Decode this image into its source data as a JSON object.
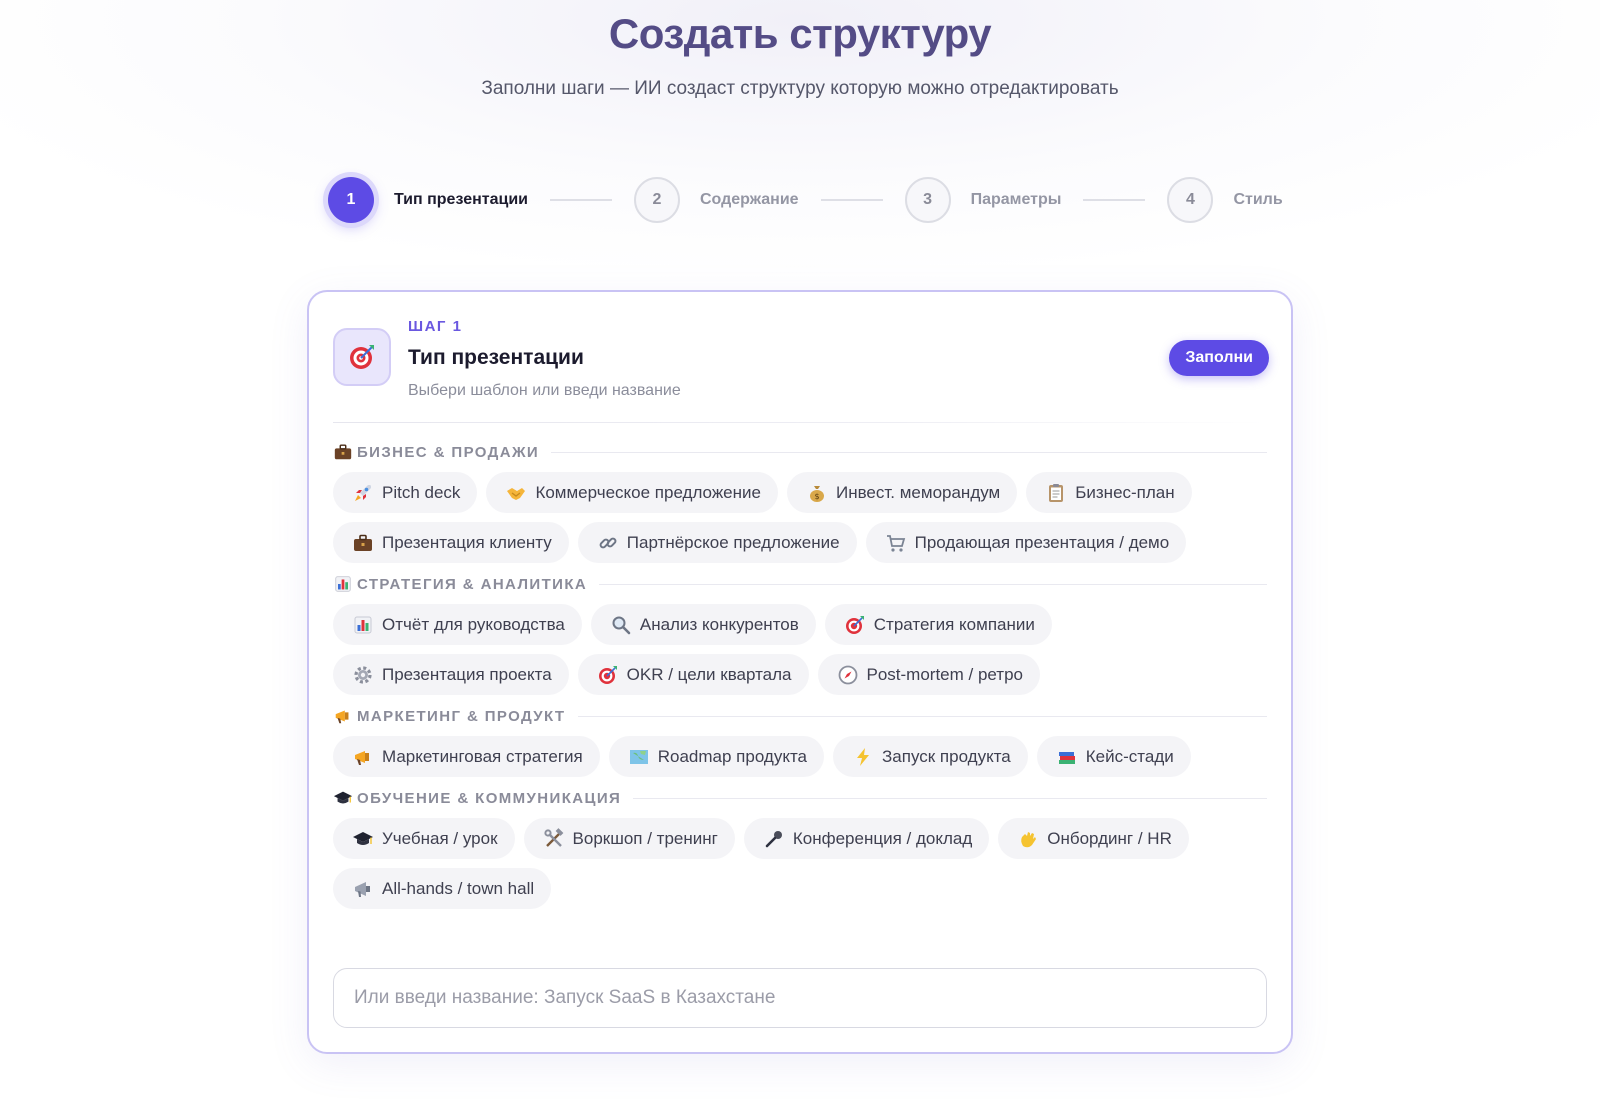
{
  "header": {
    "title": "Создать структуру",
    "subtitle": "Заполни шаги — ИИ создаст структуру которую можно отредактировать"
  },
  "stepper": [
    {
      "number": "1",
      "label": "Тип презентации",
      "active": true
    },
    {
      "number": "2",
      "label": "Содержание",
      "active": false
    },
    {
      "number": "3",
      "label": "Параметры",
      "active": false
    },
    {
      "number": "4",
      "label": "Стиль",
      "active": false
    }
  ],
  "card": {
    "step_tag": "ШАГ 1",
    "title": "Тип презентации",
    "description": "Выбери шаблон или введи название",
    "icon": "target-icon",
    "fill_button": "Заполни"
  },
  "sections": [
    {
      "title": "БИЗНЕС & ПРОДАЖИ",
      "icon": "briefcase-icon",
      "rows": [
        [
          {
            "label": "Pitch deck",
            "icon": "rocket-icon"
          },
          {
            "label": "Коммерческое предложение",
            "icon": "handshake-icon"
          },
          {
            "label": "Инвест. меморандум",
            "icon": "money-bag-icon"
          },
          {
            "label": "Бизнес-план",
            "icon": "clipboard-icon"
          }
        ],
        [
          {
            "label": "Презентация клиенту",
            "icon": "briefcase-icon"
          },
          {
            "label": "Партнёрское предложение",
            "icon": "link-icon"
          },
          {
            "label": "Продающая презентация / демо",
            "icon": "cart-icon"
          }
        ]
      ]
    },
    {
      "title": "СТРАТЕГИЯ & АНАЛИТИКА",
      "icon": "bar-chart-icon",
      "rows": [
        [
          {
            "label": "Отчёт для руководства",
            "icon": "bar-chart-icon"
          },
          {
            "label": "Анализ конкурентов",
            "icon": "magnifier-icon"
          },
          {
            "label": "Стратегия компании",
            "icon": "target-icon"
          }
        ],
        [
          {
            "label": "Презентация проекта",
            "icon": "gear-icon"
          },
          {
            "label": "OKR / цели квартала",
            "icon": "target-icon"
          },
          {
            "label": "Post-mortem / ретро",
            "icon": "compass-icon"
          }
        ]
      ]
    },
    {
      "title": "МАРКЕТИНГ & ПРОДУКТ",
      "icon": "megaphone-icon",
      "rows": [
        [
          {
            "label": "Маркетинговая стратегия",
            "icon": "megaphone-icon"
          },
          {
            "label": "Roadmap продукта",
            "icon": "map-icon"
          },
          {
            "label": "Запуск продукта",
            "icon": "lightning-icon"
          },
          {
            "label": "Кейс-стади",
            "icon": "books-icon"
          }
        ]
      ]
    },
    {
      "title": "ОБУЧЕНИЕ & КОММУНИКАЦИЯ",
      "icon": "graduation-cap-icon",
      "rows": [
        [
          {
            "label": "Учебная / урок",
            "icon": "graduation-cap-icon"
          },
          {
            "label": "Воркшоп / тренинг",
            "icon": "tools-icon"
          },
          {
            "label": "Конференция / доклад",
            "icon": "microphone-icon"
          },
          {
            "label": "Онбординг / HR",
            "icon": "waving-hand-icon"
          }
        ],
        [
          {
            "label": "All-hands / town hall",
            "icon": "loudspeaker-icon"
          }
        ]
      ]
    }
  ],
  "title_input": {
    "placeholder": "Или введи название: Запуск SaaS в Казахстане",
    "value": ""
  },
  "colors": {
    "accent": "#5d4be5",
    "title": "#544c86",
    "card_border": "#c9c3f4"
  }
}
